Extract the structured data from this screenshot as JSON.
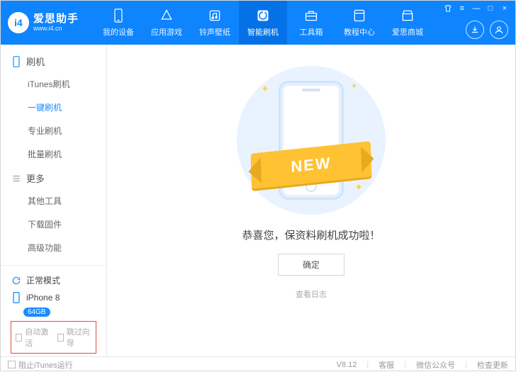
{
  "app": {
    "logo_badge": "i4",
    "title": "爱思助手",
    "subtitle": "www.i4.cn"
  },
  "nav": [
    {
      "label": "我的设备",
      "icon": "phone"
    },
    {
      "label": "应用游戏",
      "icon": "app"
    },
    {
      "label": "铃声壁纸",
      "icon": "music"
    },
    {
      "label": "智能刷机",
      "icon": "refresh",
      "active": true
    },
    {
      "label": "工具箱",
      "icon": "toolbox"
    },
    {
      "label": "教程中心",
      "icon": "book"
    },
    {
      "label": "爱思商城",
      "icon": "store"
    }
  ],
  "window_controls": {
    "skin": "皮肤",
    "menu": "≡",
    "min": "—",
    "max": "□",
    "close": "×"
  },
  "sidebar": {
    "sections": [
      {
        "title": "刷机",
        "icon": "device",
        "items": [
          {
            "label": "iTunes刷机"
          },
          {
            "label": "一键刷机",
            "active": true
          },
          {
            "label": "专业刷机"
          },
          {
            "label": "批量刷机"
          }
        ]
      },
      {
        "title": "更多",
        "icon": "list",
        "items": [
          {
            "label": "其他工具"
          },
          {
            "label": "下载固件"
          },
          {
            "label": "高级功能"
          }
        ]
      }
    ],
    "mode": "正常模式",
    "device": "iPhone 8",
    "storage": "64GB",
    "checkboxes": {
      "auto_activate": "自动激活",
      "skip_setup": "跳过向导"
    }
  },
  "main": {
    "ribbon": "NEW",
    "success": "恭喜您，保资料刷机成功啦！",
    "ok": "确定",
    "log": "查看日志"
  },
  "footer": {
    "block_itunes": "阻止iTunes运行",
    "version": "V8.12",
    "support": "客服",
    "wechat": "微信公众号",
    "update": "检查更新"
  }
}
